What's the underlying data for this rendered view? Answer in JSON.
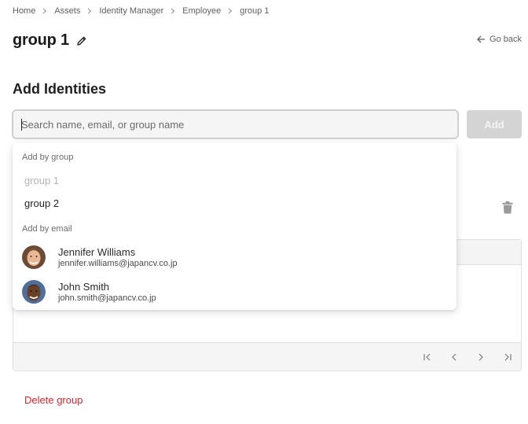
{
  "breadcrumb": {
    "items": [
      "Home",
      "Assets",
      "Identity Manager",
      "Employee",
      "group 1"
    ],
    "separator_icon": "chevron-right-icon"
  },
  "header": {
    "title": "group 1",
    "edit_icon": "pencil-icon",
    "go_back_label": "Go back",
    "go_back_icon": "arrow-left-icon"
  },
  "add_identities": {
    "title": "Add Identities",
    "search": {
      "value": "",
      "placeholder": "Search name, email, or group name"
    },
    "add_button_label": "Add",
    "add_button_state": "disabled"
  },
  "dropdown": {
    "group_section_label": "Add by group",
    "groups": [
      {
        "name": "group 1",
        "disabled": true
      },
      {
        "name": "group 2",
        "disabled": false
      }
    ],
    "email_section_label": "Add by email",
    "people": [
      {
        "name": "Jennifer Williams",
        "email": "jennifer.williams@japancv.co.jp",
        "avatar": "avatar-photo"
      },
      {
        "name": "John Smith",
        "email": "john.smith@japancv.co.jp",
        "avatar": "avatar-photo"
      }
    ]
  },
  "table": {
    "delete_icon": "trash-icon",
    "pagination": [
      "first-page-icon",
      "prev-page-icon",
      "next-page-icon",
      "last-page-icon"
    ]
  },
  "footer": {
    "delete_group_label": "Delete group"
  },
  "colors": {
    "danger": "#d9262c",
    "disabled_button": "#d4d4d4",
    "input_border": "#cfcfcf"
  }
}
